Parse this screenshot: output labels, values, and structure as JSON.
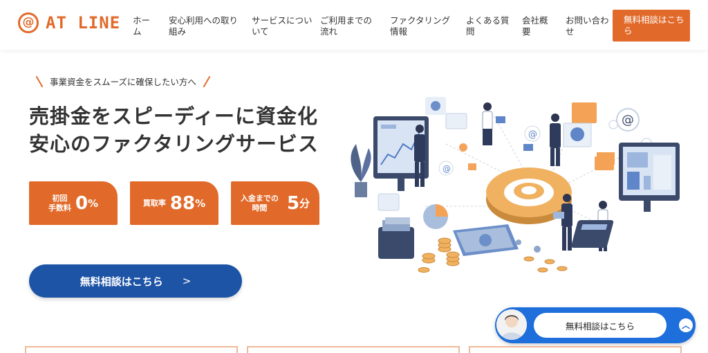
{
  "brand": {
    "logo_mark": "@",
    "logo_text": "AT LINE",
    "accent": "#e16a2a",
    "blue": "#1d54a6"
  },
  "nav": {
    "items": [
      {
        "line1": "ホー",
        "line2": "ム"
      },
      {
        "line1": "安心利用への取り",
        "line2": "組み"
      },
      {
        "line1": "サービスについ",
        "line2": "いて"
      },
      {
        "line1": "ご利用までの",
        "line2": "流れ"
      },
      {
        "line1": "ファクタリング",
        "line2": "情報"
      },
      {
        "line1": "よくある質",
        "line2": "問"
      },
      {
        "line1": "会社概",
        "line2": "要"
      },
      {
        "line1": "お問い合わ",
        "line2": "せ"
      }
    ],
    "cta": {
      "line1": "無料相談はこち",
      "line2": "ら"
    }
  },
  "hero": {
    "tagline": "事業資金をスムーズに確保したい方へ",
    "headline_line1": "売掛金をスピーディーに資金化",
    "headline_line2": "安心のファクタリングサービス",
    "stats": [
      {
        "label_line1": "初回",
        "label_line2": "手数料",
        "value": "0",
        "unit": "%"
      },
      {
        "label_line1": "買取率",
        "label_line2": "",
        "value": "88",
        "unit": "%"
      },
      {
        "label_line1": "入金までの",
        "label_line2": "時間",
        "value": "5",
        "unit": "分"
      }
    ],
    "cta_label": "無料相談はこちら",
    "cta_chevron": ">"
  },
  "chat_widget": {
    "label": "無料相談はこちら",
    "toggle_icon": "chevron-up-icon"
  }
}
